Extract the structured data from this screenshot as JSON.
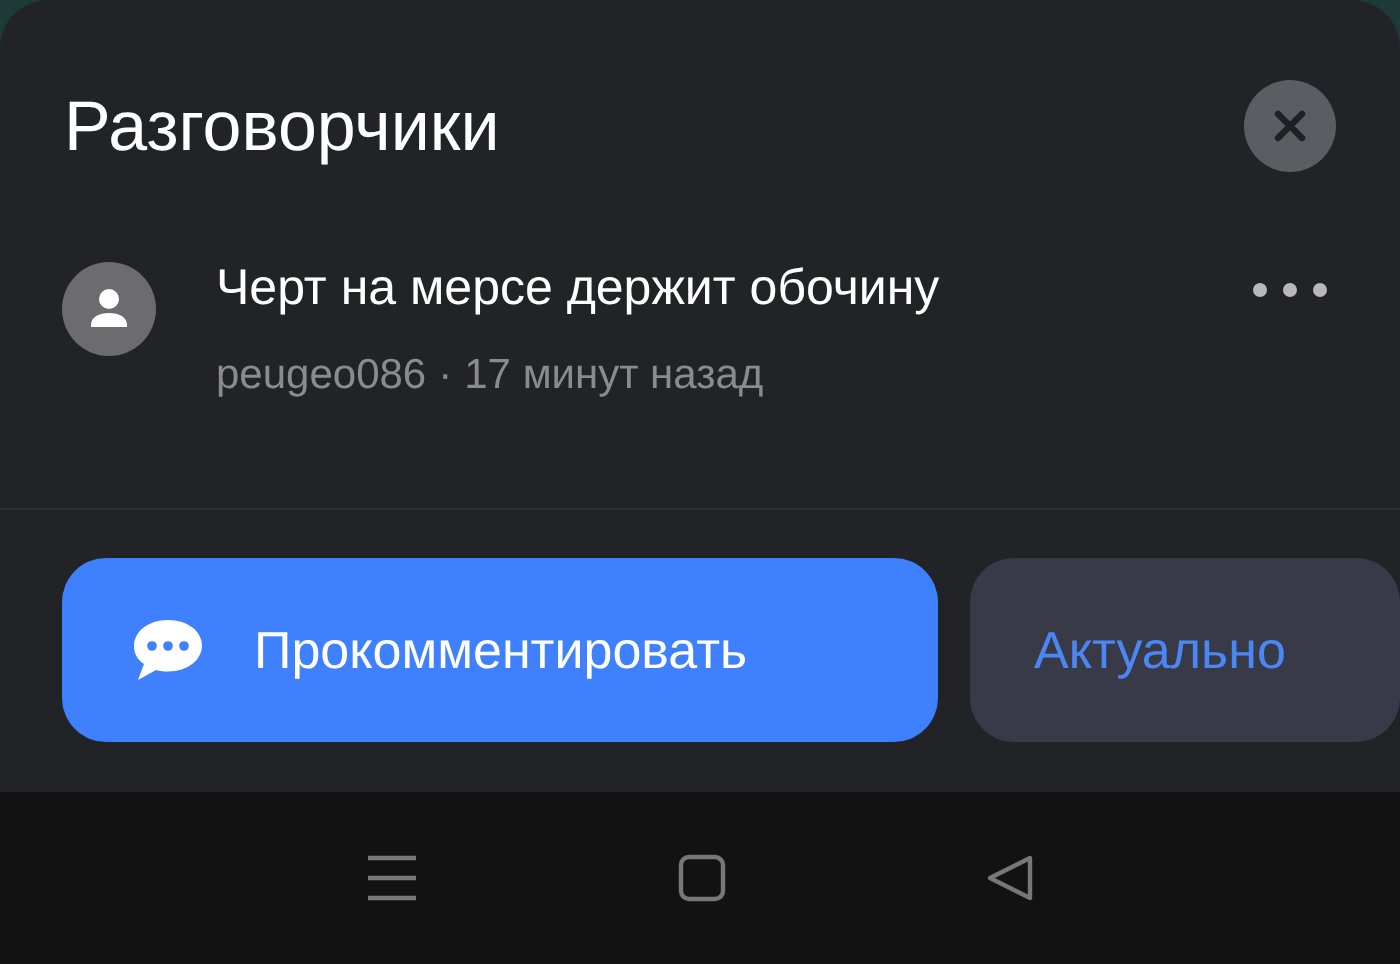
{
  "sheet": {
    "title": "Разговорчики"
  },
  "comment": {
    "text": "Черт на мерсе держит обочину",
    "author": "peugeo086",
    "separator": "·",
    "time": "17 минут назад"
  },
  "buttons": [
    {
      "kind": "primary",
      "label": "Прокомментировать"
    },
    {
      "kind": "secondary",
      "label": "Актуально"
    }
  ]
}
